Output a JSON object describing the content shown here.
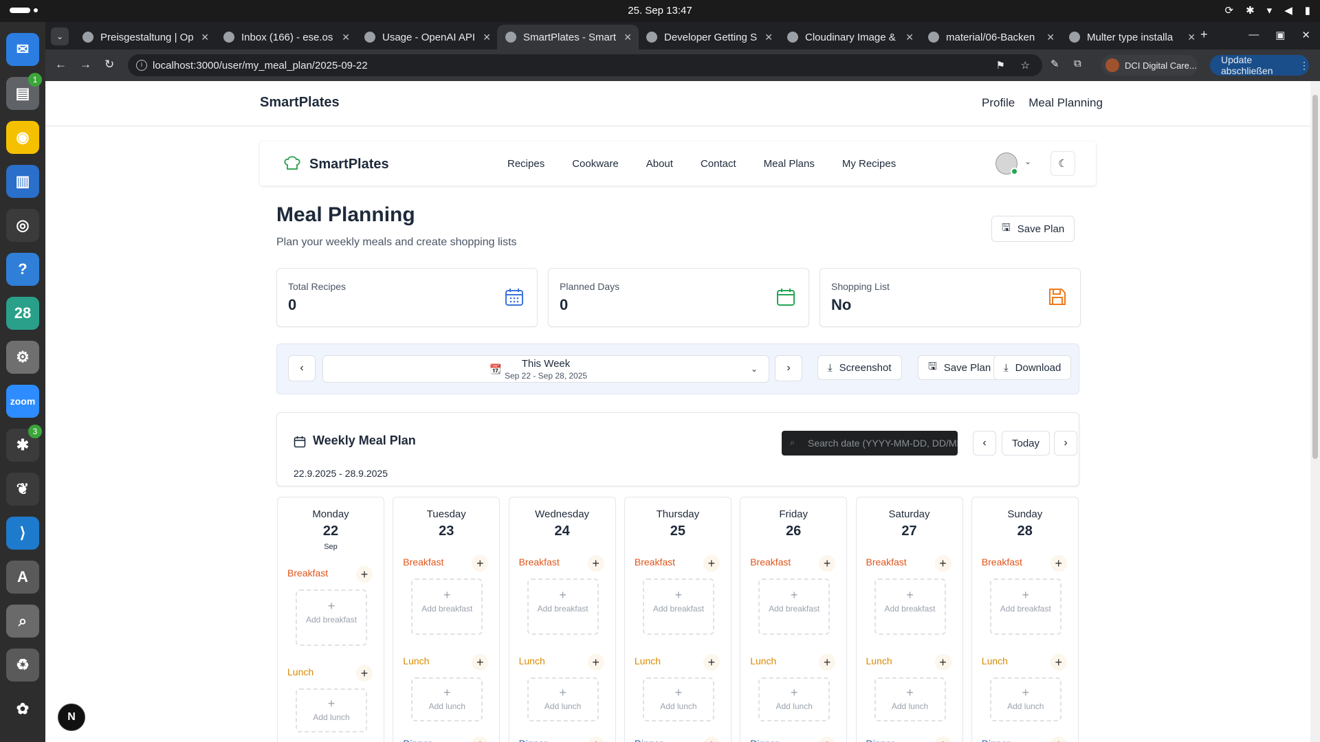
{
  "system": {
    "clock": "25. Sep  13:47"
  },
  "dock": [
    {
      "name": "thunderbird",
      "color": "#2b7de1",
      "glyph": "✉",
      "badge": ""
    },
    {
      "name": "files",
      "color": "#5f6368",
      "glyph": "▤",
      "badge": "1"
    },
    {
      "name": "rhythmbox",
      "color": "#f5c000",
      "glyph": "◉",
      "badge": ""
    },
    {
      "name": "writer",
      "color": "#2a6fc9",
      "glyph": "▥",
      "badge": ""
    },
    {
      "name": "chrome",
      "color": "#3b3b3b",
      "glyph": "◎",
      "badge": ""
    },
    {
      "name": "help",
      "color": "#2f7fd8",
      "glyph": "?",
      "badge": ""
    },
    {
      "name": "calendar",
      "color": "#2aa08a",
      "glyph": "28",
      "badge": ""
    },
    {
      "name": "settings",
      "color": "#6f6f6f",
      "glyph": "⚙",
      "badge": ""
    },
    {
      "name": "zoom",
      "color": "#2d8cff",
      "glyph": "zoom",
      "badge": ""
    },
    {
      "name": "slack",
      "color": "#3b3b3b",
      "glyph": "✱",
      "badge": "3"
    },
    {
      "name": "mongodb",
      "color": "#3b3b3b",
      "glyph": "❦",
      "badge": ""
    },
    {
      "name": "vscode",
      "color": "#1e7acc",
      "glyph": "⟩",
      "badge": ""
    },
    {
      "name": "software",
      "color": "#5a5a5a",
      "glyph": "A",
      "badge": ""
    },
    {
      "name": "screenshot",
      "color": "#6a6a6a",
      "glyph": "⌕",
      "badge": ""
    },
    {
      "name": "trash",
      "color": "#5a5a5a",
      "glyph": "♻",
      "badge": ""
    },
    {
      "name": "apps-grid",
      "color": "#2d2d2d",
      "glyph": "✿",
      "badge": ""
    }
  ],
  "browser": {
    "tabs": [
      {
        "title": "Preisgestaltung | Op",
        "active": false
      },
      {
        "title": "Inbox (166) - ese.os",
        "active": false
      },
      {
        "title": "Usage - OpenAI API",
        "active": false
      },
      {
        "title": "SmartPlates - Smart",
        "active": true
      },
      {
        "title": "Developer Getting S",
        "active": false
      },
      {
        "title": "Cloudinary Image &",
        "active": false
      },
      {
        "title": "material/06-Backen",
        "active": false
      },
      {
        "title": "Multer type installa",
        "active": false
      }
    ],
    "new_tab": "+",
    "url": "localhost:3000/user/my_meal_plan/2025-09-22",
    "profile": "DCI Digital Care...",
    "update": "Update abschließen"
  },
  "app": {
    "outer_brand": "SmartPlates",
    "outer_nav": [
      "Profile",
      "Meal Planning"
    ],
    "brand": "SmartPlates",
    "nav": [
      "Recipes",
      "Cookware",
      "About",
      "Contact",
      "Meal Plans",
      "My Recipes"
    ],
    "title": "Meal Planning",
    "subtitle": "Plan your weekly meals and create shopping lists",
    "save_plan": "Save Plan",
    "stats": [
      {
        "label": "Total Recipes",
        "value": "0",
        "color": "#3b72d9"
      },
      {
        "label": "Planned Days",
        "value": "0",
        "color": "#22a653"
      },
      {
        "label": "Shopping List",
        "value": "No",
        "color": "#f07a1a"
      }
    ],
    "week": {
      "title": "This Week",
      "range": "Sep 22 - Sep 28, 2025",
      "screenshot": "Screenshot",
      "save_plan": "Save Plan",
      "download": "Download"
    },
    "plan": {
      "title": "Weekly Meal Plan",
      "range": "22.9.2025 - 28.9.2025",
      "search_placeholder": "Search date (YYYY-MM-DD, DD/MM)",
      "today": "Today"
    },
    "days": [
      {
        "name": "Monday",
        "num": "22",
        "month": "Sep"
      },
      {
        "name": "Tuesday",
        "num": "23",
        "month": ""
      },
      {
        "name": "Wednesday",
        "num": "24",
        "month": ""
      },
      {
        "name": "Thursday",
        "num": "25",
        "month": ""
      },
      {
        "name": "Friday",
        "num": "26",
        "month": ""
      },
      {
        "name": "Saturday",
        "num": "27",
        "month": ""
      },
      {
        "name": "Sunday",
        "num": "28",
        "month": ""
      }
    ],
    "meals": {
      "breakfast": "Breakfast",
      "lunch": "Lunch",
      "dinner": "Dinner",
      "add_breakfast": "Add breakfast",
      "add_lunch": "Add lunch"
    }
  }
}
